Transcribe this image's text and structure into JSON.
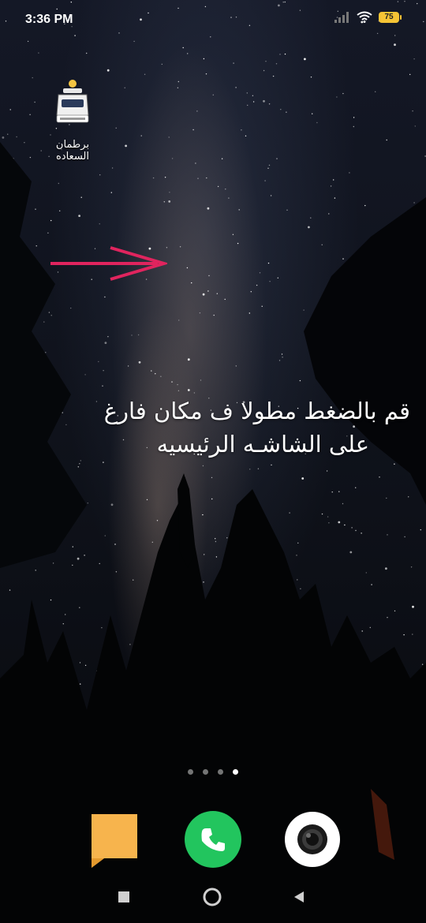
{
  "status_bar": {
    "time": "3:36 PM",
    "battery_level": "75",
    "icons": [
      "signal-icon",
      "wifi-icon",
      "battery-icon"
    ]
  },
  "home_app": {
    "label": "برطمان السعاده",
    "icon": "app-logo-icon"
  },
  "instruction": {
    "line1": "قم بالضغط مطولا ف مكان فارغ",
    "line2": "على الشاشـه الرئيسيه"
  },
  "annotation_arrow": {
    "color": "#e0245e"
  },
  "page_indicator": {
    "count": 4,
    "active_index": 3
  },
  "dock": {
    "apps": [
      "messages-icon",
      "phone-icon",
      "camera-icon"
    ],
    "colors": {
      "messages": "#f7b44d",
      "phone": "#22c55e",
      "camera": "#ffffff"
    }
  },
  "nav_bar": {
    "buttons": [
      "recents-button",
      "home-button",
      "back-button"
    ]
  }
}
